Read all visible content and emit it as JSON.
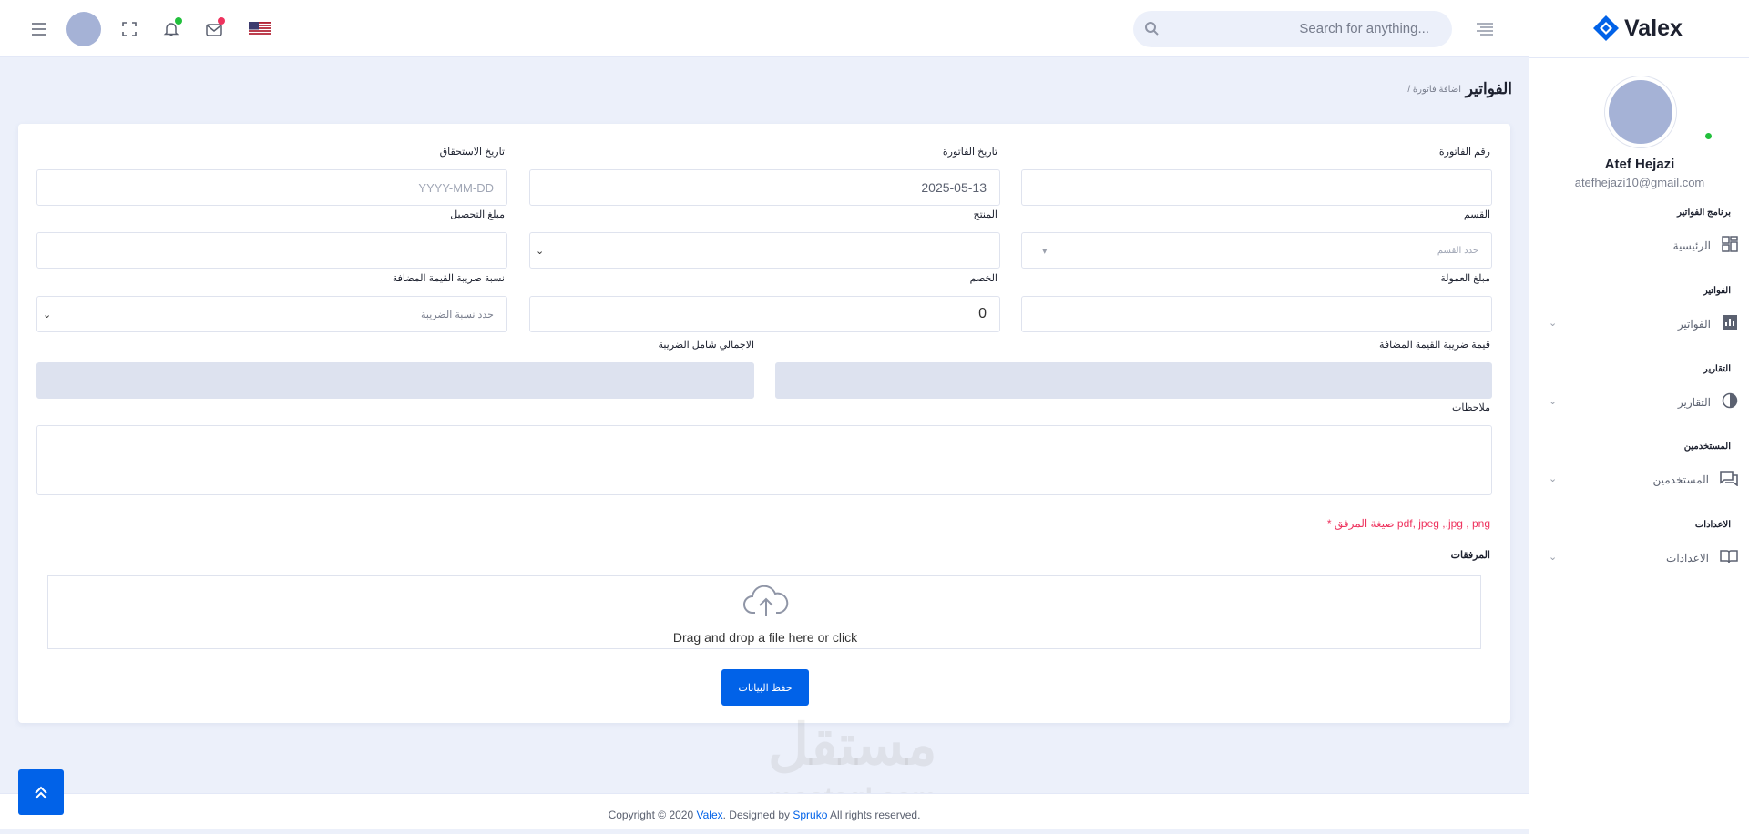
{
  "header": {
    "search_placeholder": "Search for anything...",
    "menu_icon": "hamburger-icon",
    "fullscreen_icon": "fullscreen-icon",
    "bell_icon": "bell-icon",
    "mail_icon": "mail-icon",
    "flag_icon": "us-flag-icon",
    "colors": {
      "bell_dot": "#22c03c",
      "mail_dot": "#ee335e"
    }
  },
  "sidebar": {
    "brand": "Valex",
    "user_name": "Atef Hejazi",
    "user_email": "atefhejazi10@gmail.com",
    "sections": [
      {
        "title": "برنامج الفواتير",
        "item": "الرئيسية",
        "icon": "dashboard-icon",
        "has_chevron": false
      },
      {
        "title": "الفواتير",
        "item": "الفواتير",
        "icon": "chart-bar-icon",
        "has_chevron": true
      },
      {
        "title": "التقارير",
        "item": "التقارير",
        "icon": "pie-chart-icon",
        "has_chevron": true
      },
      {
        "title": "المستخدمين",
        "item": "المستخدمين",
        "icon": "chat-icon",
        "has_chevron": true
      },
      {
        "title": "الاعدادات",
        "item": "الاعدادات",
        "icon": "book-icon",
        "has_chevron": true
      }
    ]
  },
  "page": {
    "title": "الفواتير",
    "breadcrumb": "/ اضافة فاتورة"
  },
  "form": {
    "invoice_number_label": "رقم الفاتورة",
    "invoice_number_value": "",
    "invoice_date_label": "تاريخ الفاتورة",
    "invoice_date_value": "2025-05-13",
    "due_date_label": "تاريخ الاستحقاق",
    "due_date_placeholder": "YYYY-MM-DD",
    "section_label": "القسم",
    "section_placeholder": "حدد القسم",
    "product_label": "المنتج",
    "collection_label": "مبلغ التحصيل",
    "commission_label": "مبلغ العمولة",
    "discount_label": "الخصم",
    "discount_value": "0",
    "vat_rate_label": "نسبة ضريبة القيمة المضافة",
    "vat_rate_placeholder": "حدد نسبة الضريبة",
    "vat_value_label": "قيمة ضريبة القيمة المضافة",
    "total_label": "الاجمالي شامل الضريبة",
    "notes_label": "ملاحظات",
    "attachment_format_note": "* صيغة المرفق  pdf, jpeg ,.jpg , png",
    "attachments_label": "المرفقات",
    "dropzone_text": "Drag and drop a file here or click",
    "save_button": "حفظ البيانات"
  },
  "footer": {
    "copyright_prefix": "Copyright © 2020 ",
    "brand": "Valex",
    "designed_by": ". Designed by ",
    "designer": "Spruko",
    "suffix": " All rights reserved."
  },
  "watermark": {
    "line1": "مستقل",
    "line2": "mostaql.com"
  }
}
